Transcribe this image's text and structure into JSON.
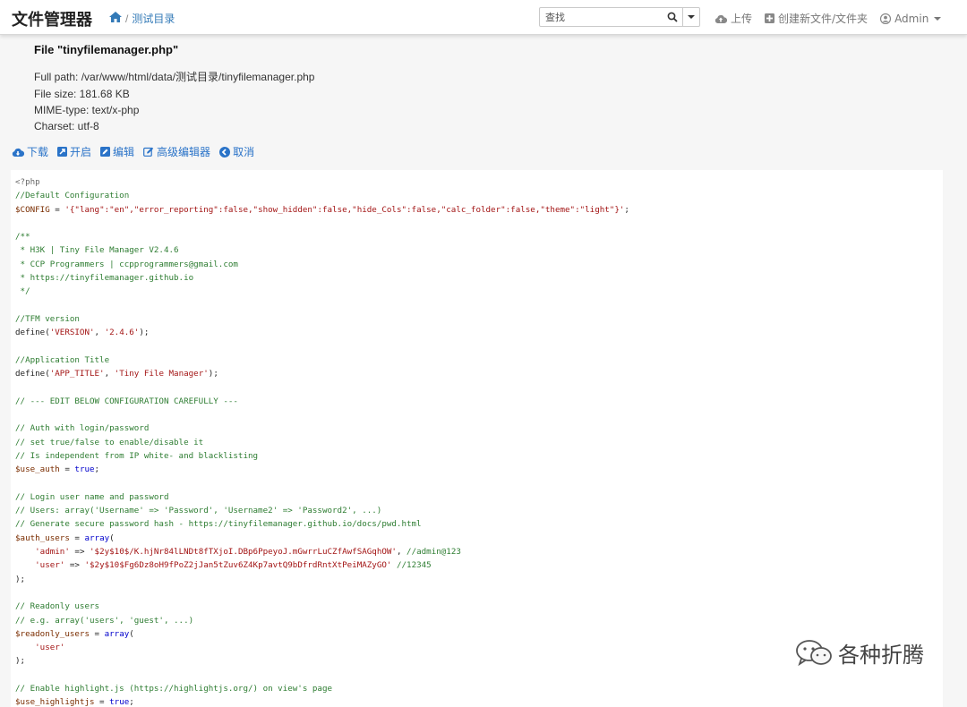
{
  "navbar": {
    "brand": "文件管理器",
    "breadcrumb": {
      "separator": "/",
      "folder": "测试目录"
    },
    "search": {
      "placeholder": "查找"
    },
    "upload_label": "上传",
    "create_label": "创建新文件/文件夹",
    "user_label": "Admin"
  },
  "file": {
    "title": "File \"tinyfilemanager.php\"",
    "full_path": "Full path: /var/www/html/data/测试目录/tinyfilemanager.php",
    "size": "File size: 181.68 KB",
    "mime": "MIME-type: text/x-php",
    "charset": "Charset: utf-8"
  },
  "actions": {
    "download": "下载",
    "open": "开启",
    "edit": "编辑",
    "advanced_edit": "高级编辑器",
    "cancel": "取消"
  },
  "code_lines": [
    [
      [
        "c-meta",
        "<?php"
      ]
    ],
    [
      [
        "c-comment",
        "//Default Configuration"
      ]
    ],
    [
      [
        "c-var",
        "$CONFIG"
      ],
      [
        "c-plain",
        " = "
      ],
      [
        "c-str",
        "'{\"lang\":\"en\",\"error_reporting\":false,\"show_hidden\":false,\"hide_Cols\":false,\"calc_folder\":false,\"theme\":\"light\"}'"
      ],
      [
        "c-plain",
        ";"
      ]
    ],
    [],
    [
      [
        "c-comment",
        "/**"
      ]
    ],
    [
      [
        "c-comment",
        " * H3K | Tiny File Manager V2.4.6"
      ]
    ],
    [
      [
        "c-comment",
        " * CCP Programmers | ccpprogrammers@gmail.com"
      ]
    ],
    [
      [
        "c-comment",
        " * https://tinyfilemanager.github.io"
      ]
    ],
    [
      [
        "c-comment",
        " */"
      ]
    ],
    [],
    [
      [
        "c-comment",
        "//TFM version"
      ]
    ],
    [
      [
        "c-plain",
        "define("
      ],
      [
        "c-str",
        "'VERSION'"
      ],
      [
        "c-plain",
        ", "
      ],
      [
        "c-str",
        "'2.4.6'"
      ],
      [
        "c-plain",
        ");"
      ]
    ],
    [],
    [
      [
        "c-comment",
        "//Application Title"
      ]
    ],
    [
      [
        "c-plain",
        "define("
      ],
      [
        "c-str",
        "'APP_TITLE'"
      ],
      [
        "c-plain",
        ", "
      ],
      [
        "c-str",
        "'Tiny File Manager'"
      ],
      [
        "c-plain",
        ");"
      ]
    ],
    [],
    [
      [
        "c-comment",
        "// --- EDIT BELOW CONFIGURATION CAREFULLY ---"
      ]
    ],
    [],
    [
      [
        "c-comment",
        "// Auth with login/password"
      ]
    ],
    [
      [
        "c-comment",
        "// set true/false to enable/disable it"
      ]
    ],
    [
      [
        "c-comment",
        "// Is independent from IP white- and blacklisting"
      ]
    ],
    [
      [
        "c-var",
        "$use_auth"
      ],
      [
        "c-plain",
        " = "
      ],
      [
        "c-kw",
        "true"
      ],
      [
        "c-plain",
        ";"
      ]
    ],
    [],
    [
      [
        "c-comment",
        "// Login user name and password"
      ]
    ],
    [
      [
        "c-comment",
        "// Users: array('Username' => 'Password', 'Username2' => 'Password2', ...)"
      ]
    ],
    [
      [
        "c-comment",
        "// Generate secure password hash - https://tinyfilemanager.github.io/docs/pwd.html"
      ]
    ],
    [
      [
        "c-var",
        "$auth_users"
      ],
      [
        "c-plain",
        " = "
      ],
      [
        "c-kw",
        "array"
      ],
      [
        "c-plain",
        "("
      ]
    ],
    [
      [
        "c-plain",
        "    "
      ],
      [
        "c-str",
        "'admin'"
      ],
      [
        "c-plain",
        " => "
      ],
      [
        "c-str",
        "'$2y$10$/K.hjNr84lLNDt8fTXjoI.DBp6PpeyoJ.mGwrrLuCZfAwfSAGqhOW'"
      ],
      [
        "c-plain",
        ", "
      ],
      [
        "c-comment",
        "//admin@123"
      ]
    ],
    [
      [
        "c-plain",
        "    "
      ],
      [
        "c-str",
        "'user'"
      ],
      [
        "c-plain",
        " => "
      ],
      [
        "c-str",
        "'$2y$10$Fg6Dz8oH9fPoZ2jJan5tZuv6Z4Kp7avtQ9bDfrdRntXtPeiMAZyGO'"
      ],
      [
        "c-plain",
        " "
      ],
      [
        "c-comment",
        "//12345"
      ]
    ],
    [
      [
        "c-plain",
        ");"
      ]
    ],
    [],
    [
      [
        "c-comment",
        "// Readonly users"
      ]
    ],
    [
      [
        "c-comment",
        "// e.g. array('users', 'guest', ...)"
      ]
    ],
    [
      [
        "c-var",
        "$readonly_users"
      ],
      [
        "c-plain",
        " = "
      ],
      [
        "c-kw",
        "array"
      ],
      [
        "c-plain",
        "("
      ]
    ],
    [
      [
        "c-plain",
        "    "
      ],
      [
        "c-str",
        "'user'"
      ]
    ],
    [
      [
        "c-plain",
        ");"
      ]
    ],
    [],
    [
      [
        "c-comment",
        "// Enable highlight.js (https://highlightjs.org/) on view's page"
      ]
    ],
    [
      [
        "c-var",
        "$use_highlightjs"
      ],
      [
        "c-plain",
        " = "
      ],
      [
        "c-kw",
        "true"
      ],
      [
        "c-plain",
        ";"
      ]
    ]
  ],
  "watermark": "各种折腾"
}
